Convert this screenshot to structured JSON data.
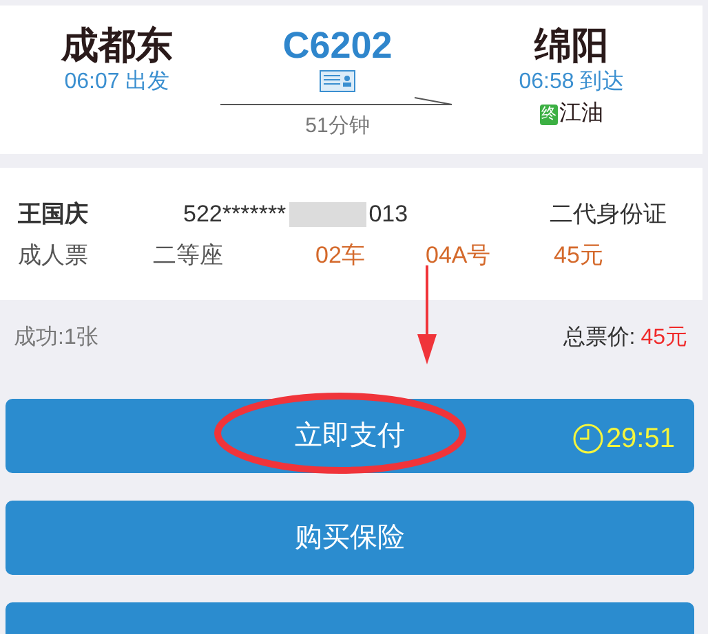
{
  "trip": {
    "from_station": "成都东",
    "depart": "06:07 出发",
    "train": "C6202",
    "duration": "51分钟",
    "to_station": "绵阳",
    "arrive": "06:58 到达",
    "terminal_badge": "终",
    "terminal": "江油"
  },
  "passenger": {
    "name": "王国庆",
    "id_start": "522*******",
    "id_end": "013",
    "id_type": "二代身份证",
    "ticket_type": "成人票",
    "seat_class": "二等座",
    "car": "02车",
    "seat": "04A号",
    "price": "45元"
  },
  "summary": {
    "count": "成功:1张",
    "total_label": "总票价:",
    "total": "45元"
  },
  "buttons": [
    {
      "label": "立即支付",
      "timer": "29:51",
      "circled": true
    },
    {
      "label": "购买保险",
      "circled": false
    },
    {
      "circled": false
    }
  ]
}
